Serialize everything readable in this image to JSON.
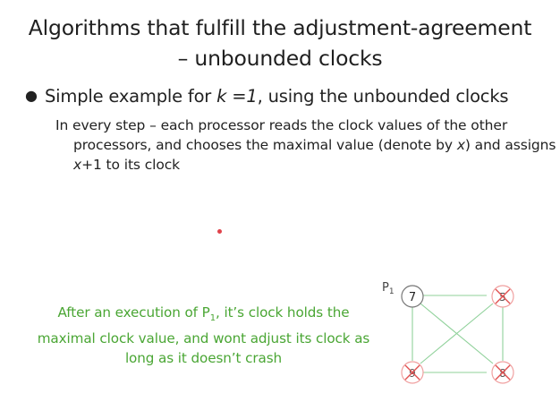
{
  "slide": {
    "title_line1": "Algorithms that fulfill the adjustment-agreement",
    "title_line2": "– unbounded clocks",
    "bullet": {
      "before": "Simple example for ",
      "k_var": "k",
      "k_eq": " =",
      "k_val": "1",
      "after": ", using the unbounded clocks"
    },
    "sub": {
      "part1": "In every step – each processor reads the clock values of the other processors, and chooses the maximal value (denote by ",
      "x1": "x",
      "part2": ") and assigns ",
      "x2": "x",
      "part3": "+1 to its clock"
    },
    "note": {
      "part1": "After an execution of P",
      "sub": "1",
      "part2": ", it’s clock holds the maximal clock value, and wont adjust its clock as long as it doesn’t crash"
    },
    "graph": {
      "node_label": "P",
      "node_label_sub": "1",
      "node_p1_value": "7",
      "node_tr_value": "5",
      "node_bl_value": "9",
      "node_br_value": "8"
    }
  },
  "colors": {
    "edge": "#8fd19a",
    "node_circle": "#f0a0a0",
    "cross": "#e05050",
    "note_text": "#4aa634",
    "p1_stroke": "#777777"
  }
}
